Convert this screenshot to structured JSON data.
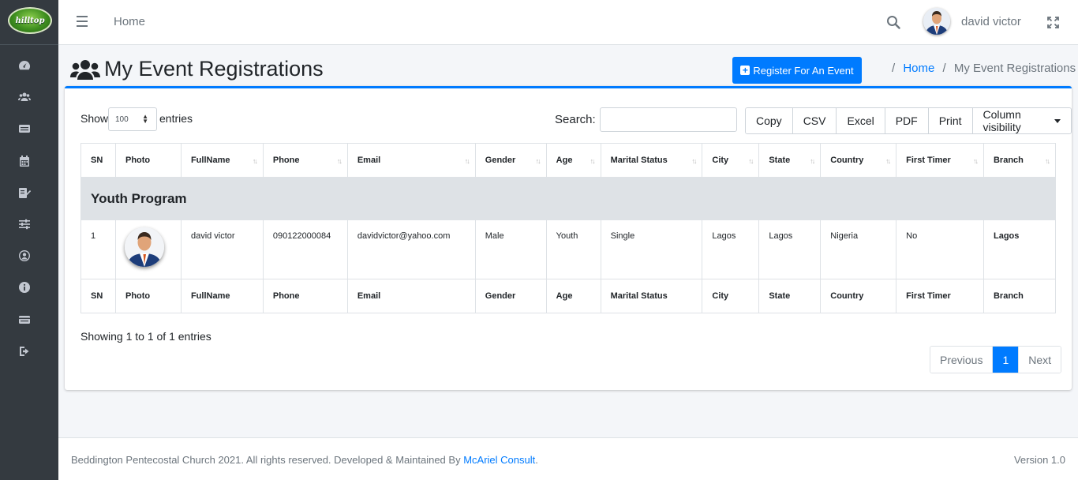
{
  "brand": {
    "logo_text": "hilltop"
  },
  "topnav": {
    "home_label": "Home",
    "user_name": "david victor"
  },
  "header": {
    "title": "My Event Registrations",
    "register_button": "Register For An Event",
    "breadcrumb": {
      "home": "Home",
      "current": "My Event Registrations"
    }
  },
  "controls": {
    "show_label": "Show",
    "entries_value": "100",
    "entries_label": "entries",
    "search_label": "Search:",
    "search_value": "",
    "buttons": [
      "Copy",
      "CSV",
      "Excel",
      "PDF",
      "Print",
      "Column visibility"
    ]
  },
  "table": {
    "columns": [
      "SN",
      "Photo",
      "FullName",
      "Phone",
      "Email",
      "Gender",
      "Age",
      "Marital Status",
      "City",
      "State",
      "Country",
      "First Timer",
      "Branch"
    ],
    "group": "Youth Program",
    "row": {
      "sn": "1",
      "fullname": "david victor",
      "phone": "090122000084",
      "email": "davidvictor@yahoo.com",
      "gender": "Male",
      "age": "Youth",
      "marital": "Single",
      "city": "Lagos",
      "state": "Lagos",
      "country": "Nigeria",
      "first_timer": "No",
      "branch": "Lagos"
    }
  },
  "info": {
    "showing": "Showing 1 to 1 of 1 entries"
  },
  "pagination": {
    "previous": "Previous",
    "current": "1",
    "next": "Next"
  },
  "footer": {
    "text": "Beddington Pentecostal Church 2021. All rights reserved. Developed & Maintained By",
    "link": "McAriel Consult",
    "suffix": ".",
    "version": "Version 1.0"
  },
  "colors": {
    "primary": "#007bff",
    "sidebar": "#343a40",
    "group_row": "#dee2e6"
  },
  "icons": [
    "tachometer-icon",
    "users-icon",
    "list-icon",
    "calendar-icon",
    "edit-icon",
    "sliders-icon",
    "user-circle-icon",
    "info-icon",
    "card-icon",
    "sign-out-icon"
  ]
}
